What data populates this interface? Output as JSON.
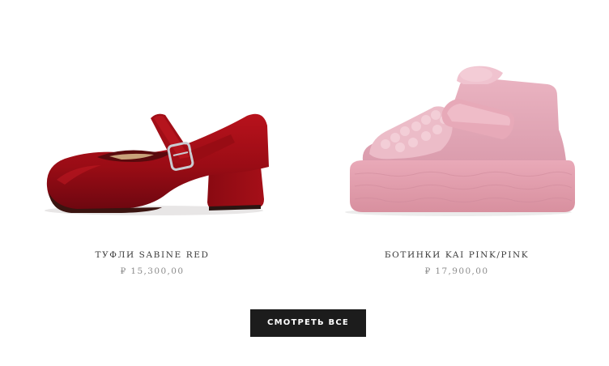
{
  "products": [
    {
      "name": "ТУФЛИ SABINE RED",
      "price": "₽ 15,300,00",
      "color": "#9e0e16"
    },
    {
      "name": "БОТИНКИ KAI PINK/PINK",
      "price": "₽ 17,900,00",
      "color": "#e3a7b6"
    }
  ],
  "view_all_label": "СМОТРЕТЬ ВСЕ",
  "colors": {
    "button_bg": "#1c1c1c",
    "button_text": "#ffffff",
    "name_text": "#3a3a3a",
    "price_text": "#8a8a8a"
  }
}
